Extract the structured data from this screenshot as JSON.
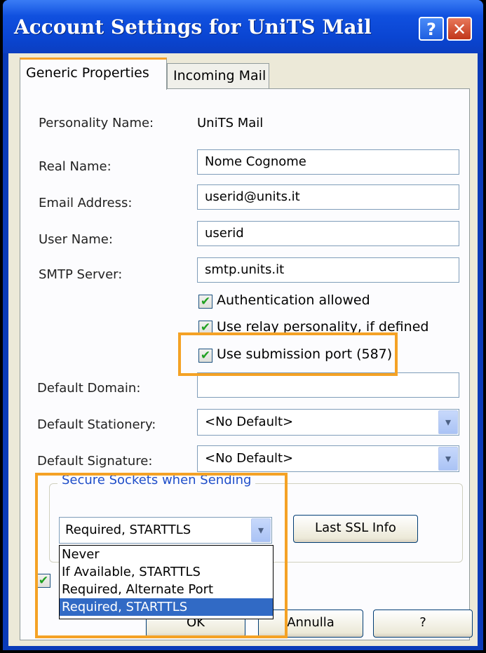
{
  "window": {
    "title": "Account Settings for UniTS Mail",
    "help_glyph": "?",
    "close_glyph": "✕"
  },
  "tabs": [
    {
      "label": "Generic Properties",
      "active": true
    },
    {
      "label": "Incoming Mail",
      "active": false
    }
  ],
  "form": {
    "personality_label": "Personality Name:",
    "personality_value": "UniTS Mail",
    "real_name_label": "Real Name:",
    "real_name_value": "Nome Cognome",
    "email_label": "Email Address:",
    "email_value": "userid@units.it",
    "user_name_label": "User Name:",
    "user_name_value": "userid",
    "smtp_label": "SMTP Server:",
    "smtp_value": "smtp.units.it",
    "default_domain_label": "Default Domain:",
    "default_domain_value": "",
    "stationery_label": "Default Stationery:",
    "stationery_value": "<No Default>",
    "signature_label": "Default Signature:",
    "signature_value": "<No Default>"
  },
  "checkboxes": {
    "auth": {
      "label": "Authentication allowed",
      "checked": true
    },
    "relay": {
      "label": "Use relay personality, if defined",
      "checked": true
    },
    "submission": {
      "label": "Use submission port (587)",
      "checked": true
    },
    "bottom": {
      "label": "",
      "checked": true
    }
  },
  "ssl": {
    "group_title": "Secure Sockets when Sending",
    "selected": "Required, STARTTLS",
    "last_ssl_button": "Last SSL Info",
    "options": [
      "Never",
      "If Available, STARTTLS",
      "Required, Alternate Port",
      "Required, STARTTLS"
    ],
    "selected_index": 3
  },
  "buttons": {
    "ok": "OK",
    "cancel": "Annulla",
    "help": "?"
  },
  "colors": {
    "highlight": "#f4a225",
    "selection": "#316ac5",
    "check": "#21a121"
  }
}
